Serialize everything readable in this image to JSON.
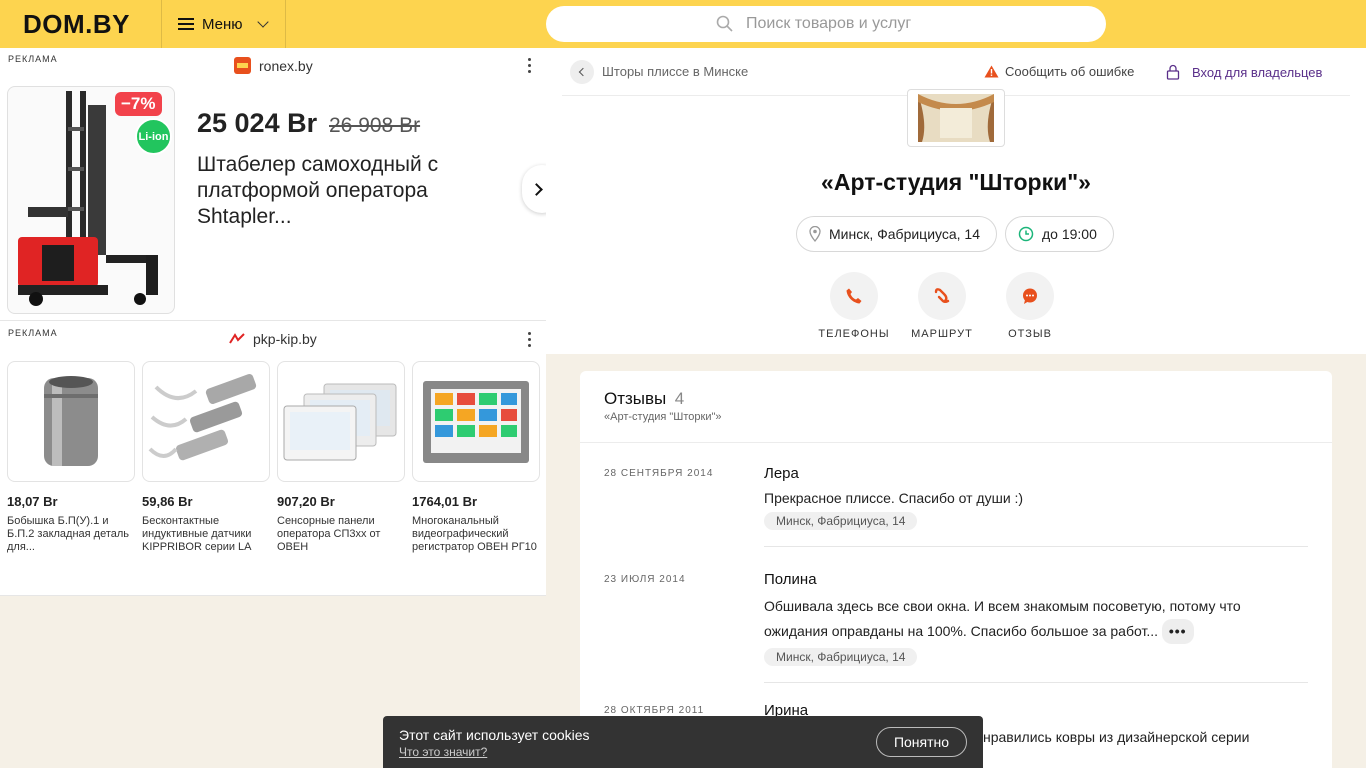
{
  "header": {
    "logo": "DOM.BY",
    "menu_label": "Меню",
    "search_placeholder": "Поиск товаров и услуг"
  },
  "ads": {
    "ad1": {
      "tag": "РЕКЛАМА",
      "source": "ronex.by",
      "discount": "−7%",
      "battery_badge": "Li-ion",
      "price_new": "25 024 Br",
      "price_old": "26 908 Br",
      "title": "Штабелер самоходный с платформой оператора Shtapler..."
    },
    "ad2": {
      "tag": "РЕКЛАМА",
      "source": "pkp-kip.by",
      "products": [
        {
          "price": "18,07 Br",
          "name": "Бобышка Б.П(У).1 и Б.П.2 закладная деталь для..."
        },
        {
          "price": "59,86 Br",
          "name": "Бесконтактные индуктивные датчики KIPPRIBOR серии LA"
        },
        {
          "price": "907,20 Br",
          "name": "Сенсорные панели оператора СП3хх от ОВЕН"
        },
        {
          "price": "1764,01 Br",
          "name": "Многоканальный видеографический регистратор ОВЕН РГ10"
        }
      ]
    }
  },
  "company_card": {
    "breadcrumb": "Шторы плиссе в Минске",
    "report_error": "Сообщить об ошибке",
    "owner_login": "Вход для владельцев",
    "name": "«Арт-студия \"Шторки\"»",
    "address": "Минск, Фабрициуса, 14",
    "hours": "до 19:00",
    "actions": {
      "phones": "ТЕЛЕФОНЫ",
      "route": "МАРШРУТ",
      "review": "ОТЗЫВ"
    }
  },
  "reviews": {
    "title": "Отзывы",
    "count": "4",
    "subtitle": "«Арт-студия \"Шторки\"»",
    "items": [
      {
        "date": "28 СЕНТЯБРЯ 2014",
        "author": "Лера",
        "text": "Прекрасное плиссе. Спасибо от души :)",
        "location": "Минск, Фабрициуса, 14"
      },
      {
        "date": "23 ИЮЛЯ 2014",
        "author": "Полина",
        "text": "Обшивала здесь все свои окна. И всем знакомым посоветую, потому что ожидания оправданы на 100%. Спасибо большое за работ...",
        "more": "•••",
        "location": "Минск, Фабрициуса, 14"
      },
      {
        "date": "28 ОКТЯБРЯ 2011",
        "author": "Ирина",
        "text": "нравились ковры из дизайнерской серии"
      }
    ]
  },
  "cookie_banner": {
    "title": "Этот сайт использует cookies",
    "link": "Что это значит?",
    "button": "Понятно"
  },
  "colors": {
    "header_bg": "#fdd44f",
    "action_icon": "#e8501d",
    "owner_link": "#5a2f8a",
    "discount_badge": "#f2424b",
    "li_ion_badge": "#22c55e"
  }
}
